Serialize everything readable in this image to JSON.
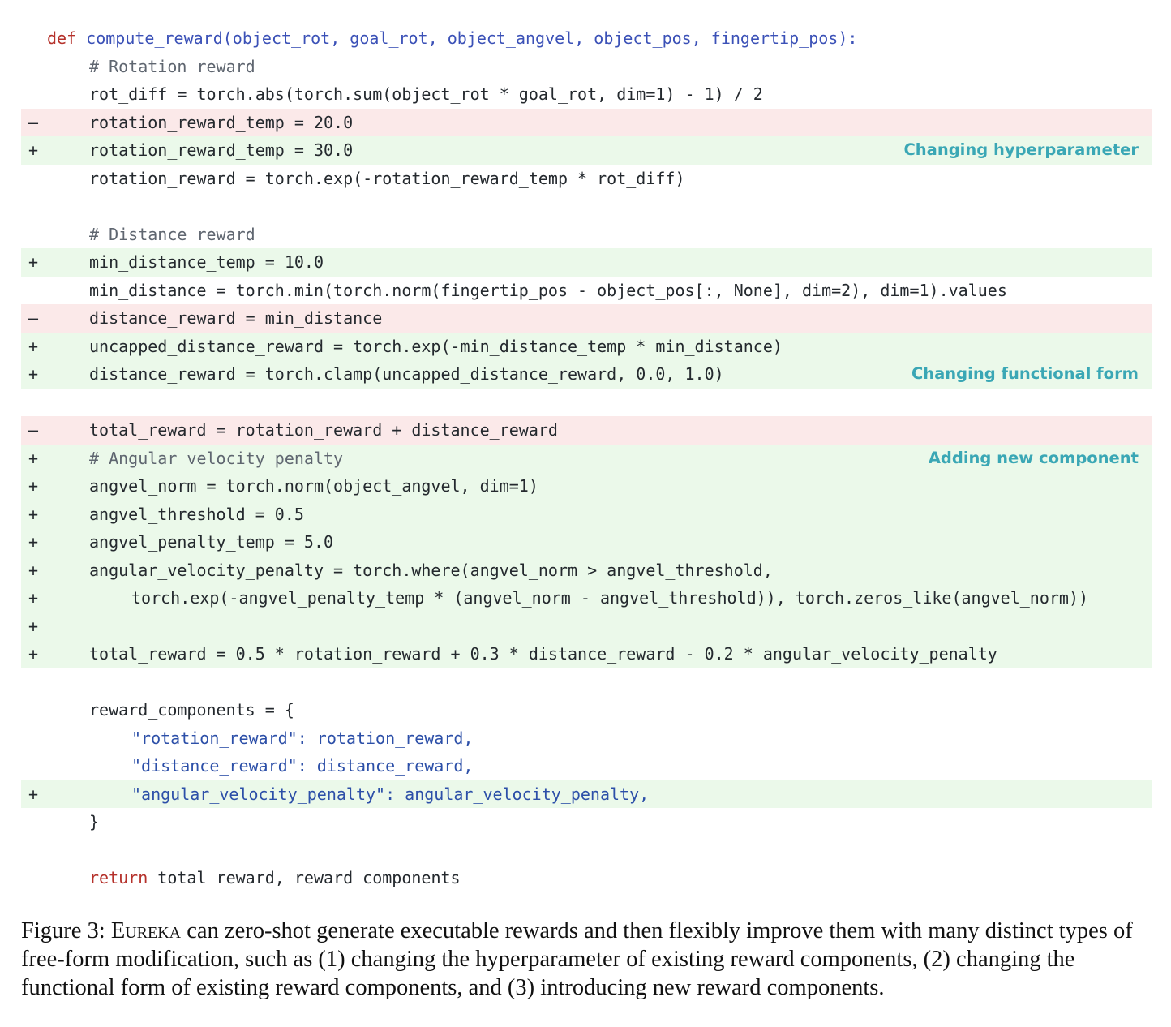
{
  "annotations": {
    "hyperparameter": "Changing hyperparameter",
    "functional_form": "Changing functional form",
    "new_component": "Adding new component"
  },
  "diff": {
    "del_marker": "–",
    "add_marker": "+"
  },
  "code": {
    "l01": "compute_reward(object_rot, goal_rot, object_angvel, object_pos, fingertip_pos):",
    "l02": "# Rotation reward",
    "l03": "rot_diff = torch.abs(torch.sum(object_rot * goal_rot, dim=1) - 1) / 2",
    "l04": "rotation_reward_temp = 20.0",
    "l05": "rotation_reward_temp = 30.0",
    "l06": "rotation_reward = torch.exp(-rotation_reward_temp * rot_diff)",
    "l08": "# Distance reward",
    "l09": "min_distance_temp = 10.0",
    "l10": "min_distance = torch.min(torch.norm(fingertip_pos - object_pos[:, None], dim=2), dim=1).values",
    "l11": "distance_reward = min_distance",
    "l12": "uncapped_distance_reward = torch.exp(-min_distance_temp * min_distance)",
    "l13": "distance_reward = torch.clamp(uncapped_distance_reward, 0.0, 1.0)",
    "l15": "total_reward = rotation_reward + distance_reward",
    "l16": "# Angular velocity penalty",
    "l17": "angvel_norm = torch.norm(object_angvel, dim=1)",
    "l18": "angvel_threshold = 0.5",
    "l19": "angvel_penalty_temp = 5.0",
    "l20": "angular_velocity_penalty = torch.where(angvel_norm > angvel_threshold,",
    "l21": "torch.exp(-angvel_penalty_temp * (angvel_norm - angvel_threshold)), torch.zeros_like(angvel_norm))",
    "l23": "total_reward = 0.5 * rotation_reward + 0.3 * distance_reward - 0.2 * angular_velocity_penalty",
    "l25": "reward_components = {",
    "l26": "\"rotation_reward\": rotation_reward,",
    "l27": "\"distance_reward\": distance_reward,",
    "l28": "\"angular_velocity_penalty\": angular_velocity_penalty,",
    "l29": "}",
    "l31": "total_reward, reward_components"
  },
  "keywords": {
    "def": "def",
    "return": "return"
  },
  "caption": {
    "label": "Figure 3: ",
    "name": "Eureka",
    "text": " can zero-shot generate executable rewards and then flexibly improve them with many distinct types of free-form modification, such as (1) changing the hyperparameter of existing reward components, (2) changing the functional form of existing reward components, and (3) introducing new reward components."
  },
  "colors": {
    "deleted_bg": "#fbe9e9",
    "added_bg": "#ebf9ea",
    "annotation": "#3aa7b5",
    "keyword": "#b5312b",
    "function": "#3b51b7"
  }
}
